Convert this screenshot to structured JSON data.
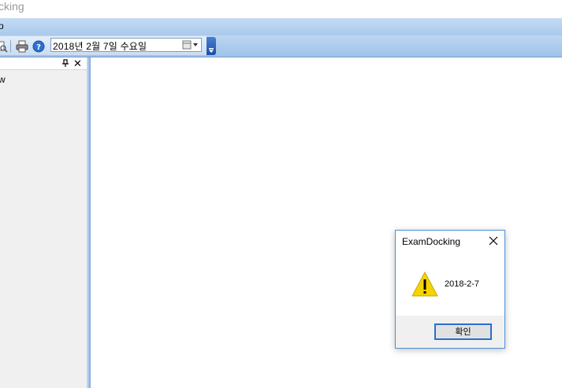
{
  "window": {
    "title_partial": "cking"
  },
  "menu": {
    "items": [
      {
        "label": "p"
      }
    ]
  },
  "toolbar": {
    "icons": [
      "preview-icon",
      "print-icon",
      "help-icon"
    ],
    "date_value": "2018년   2월   7일 수요일"
  },
  "dock_panel": {
    "item_label": "w"
  },
  "message_box": {
    "title": "ExamDocking",
    "message": "2018-2-7",
    "ok_label": "확인"
  },
  "colors": {
    "menubar": "#b6d1f0",
    "toolbar": "#cadcf2",
    "accent_blue": "#2a6fce",
    "warning_yellow": "#f5d400"
  }
}
